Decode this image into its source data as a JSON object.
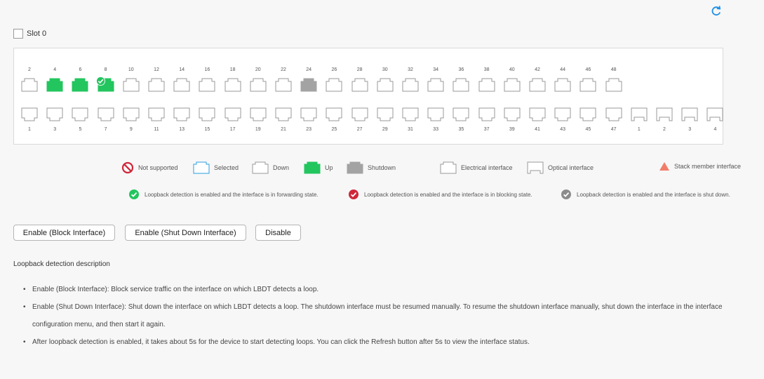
{
  "refresh": {
    "icon": "refresh-icon",
    "color": "#1f8fe6"
  },
  "slot": {
    "label": "Slot 0",
    "checked": false
  },
  "ports": {
    "top_labels": [
      "2",
      "4",
      "6",
      "8",
      "10",
      "12",
      "14",
      "16",
      "18",
      "20",
      "22",
      "24",
      "26",
      "28",
      "30",
      "32",
      "34",
      "36",
      "38",
      "40",
      "42",
      "44",
      "46",
      "48"
    ],
    "top_states": [
      "down",
      "up",
      "up",
      "up-loop-forwarding",
      "down",
      "down",
      "down",
      "down",
      "down",
      "down",
      "down",
      "shutdown",
      "down",
      "down",
      "down",
      "down",
      "down",
      "down",
      "down",
      "down",
      "down",
      "down",
      "down",
      "down"
    ],
    "bottom_labels": [
      "1",
      "3",
      "5",
      "7",
      "9",
      "11",
      "13",
      "15",
      "17",
      "19",
      "21",
      "23",
      "25",
      "27",
      "29",
      "31",
      "33",
      "35",
      "37",
      "39",
      "41",
      "43",
      "45",
      "47"
    ],
    "optical_labels": [
      "1",
      "2",
      "3",
      "4"
    ]
  },
  "colors": {
    "up": "#22c55e",
    "shutdown": "#a3a3a3",
    "selected": "#2a9fe0",
    "forwarding": "#22c55e",
    "blocking": "#d0263a",
    "shutdown_check": "#8c8c8c",
    "stack": "#f27c6a"
  },
  "legend": {
    "not_supported": "Not supported",
    "selected": "Selected",
    "down": "Down",
    "up": "Up",
    "shutdown": "Shutdown",
    "electrical": "Electrical interface",
    "optical": "Optical interface",
    "stack": "Stack member interface"
  },
  "loopback_legend": {
    "forwarding": "Loopback detection is enabled and the interface is in forwarding state.",
    "blocking": "Loopback detection is enabled and the interface is in blocking state.",
    "shutdown": "Loopback detection is enabled and the interface is shut down."
  },
  "buttons": {
    "enable_block": "Enable (Block Interface)",
    "enable_shutdown": "Enable (Shut Down Interface)",
    "disable": "Disable"
  },
  "description": {
    "title": "Loopback detection description",
    "items": [
      "Enable (Block Interface): Block service traffic on the interface on which LBDT detects a loop.",
      "Enable (Shut Down Interface): Shut down the interface on which LBDT detects a loop. The shutdown interface must be resumed manually. To resume the shutdown interface manually, shut down the interface in the interface configuration menu, and then start it again.",
      "After loopback detection is enabled, it takes about 5s for the device to start detecting loops. You can click the Refresh button after 5s to view the interface status."
    ]
  }
}
